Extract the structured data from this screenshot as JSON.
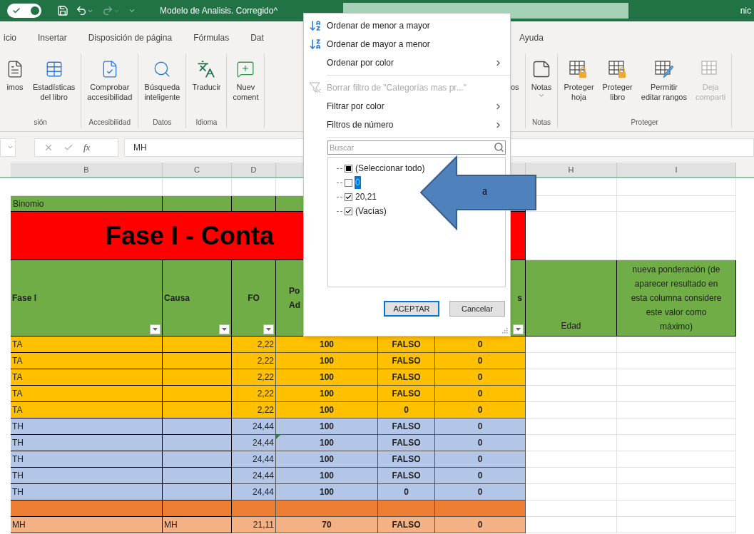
{
  "title_bar": {
    "autosave": {
      "on": true
    },
    "title": "Modelo de Analisis. Corregido^",
    "user": "nic"
  },
  "tabs": {
    "left": [
      {
        "label": "icio"
      },
      {
        "label": "Insertar"
      },
      {
        "label": "Disposición de página"
      },
      {
        "label": "Fórmulas"
      },
      {
        "label": "Dat"
      }
    ],
    "right": [
      {
        "label": "Ayuda"
      }
    ]
  },
  "ribbon": {
    "left_groups": [
      {
        "label": "sión",
        "buttons": [
          {
            "lines": [
              "imos"
            ]
          },
          {
            "lines": [
              "Estadísticas",
              "del libro"
            ]
          }
        ]
      },
      {
        "label": "Accesibilidad",
        "buttons": [
          {
            "lines": [
              "Comprobar",
              "accesibilidad"
            ]
          }
        ]
      },
      {
        "label": "Datos",
        "buttons": [
          {
            "lines": [
              "Búsqueda",
              "inteligente"
            ]
          }
        ]
      },
      {
        "label": "Idioma",
        "buttons": [
          {
            "lines": [
              "Traducir"
            ]
          }
        ]
      },
      {
        "buttons": [
          {
            "lines": [
              "Nuev",
              "coment"
            ]
          }
        ]
      }
    ],
    "right_groups": [
      {
        "buttons": [
          {
            "lines": [
              "os"
            ]
          }
        ]
      },
      {
        "label": "Notas",
        "buttons": [
          {
            "lines": [
              "Notas"
            ],
            "dropdown": true
          }
        ]
      },
      {
        "label": "Proteger",
        "buttons": [
          {
            "lines": [
              "Proteger",
              "hoja"
            ],
            "disabled": false
          },
          {
            "lines": [
              "Proteger",
              "libro"
            ],
            "disabled": false
          },
          {
            "lines": [
              "Permitir",
              "editar rangos"
            ],
            "disabled": false
          },
          {
            "lines": [
              "Deja",
              "comparti"
            ],
            "disabled": true
          }
        ]
      }
    ]
  },
  "formula_bar": {
    "function_label": "fx",
    "value": "MH"
  },
  "sheet": {
    "column_headers": [
      "B",
      "C",
      "D",
      "H",
      "I"
    ],
    "label_row": "Binomio",
    "title": "Fase I - Conta",
    "header": [
      {
        "lines": [
          "Fase I"
        ],
        "filter": true
      },
      {
        "lines": [
          "Causa"
        ],
        "filter": true
      },
      {
        "lines": [
          "FO"
        ],
        "filter": true
      },
      {
        "lines": [
          "Po",
          "Ad"
        ],
        "filter": false
      },
      {
        "lines": [
          "s"
        ],
        "filter": true
      },
      {
        "lines": [
          "Edad"
        ],
        "filter": false
      },
      {
        "lines": [
          "nueva ponderación (de",
          "aparecer resultado en",
          "esta columna considere",
          "este valor como",
          "máximo)"
        ],
        "filter": false
      }
    ],
    "rows": [
      {
        "color": "#ffc000",
        "marker": false,
        "fase_i": "TA",
        "fo": "2,22",
        "column_e": "100",
        "column_f": "FALSO",
        "column_g": "0"
      },
      {
        "color": "#ffc000",
        "marker": false,
        "fase_i": "TA",
        "fo": "2,22",
        "column_e": "100",
        "column_f": "FALSO",
        "column_g": "0"
      },
      {
        "color": "#ffc000",
        "marker": false,
        "fase_i": "TA",
        "fo": "2,22",
        "column_e": "100",
        "column_f": "FALSO",
        "column_g": "0"
      },
      {
        "color": "#ffc000",
        "marker": false,
        "fase_i": "TA",
        "fo": "2,22",
        "column_e": "100",
        "column_f": "FALSO",
        "column_g": "0"
      },
      {
        "color": "#ffc000",
        "marker": false,
        "fase_i": "TA",
        "fo": "2,22",
        "column_e": "100",
        "column_f": "0",
        "column_g": "0"
      },
      {
        "color": "#b4c6e7",
        "marker": false,
        "fase_i": "TH",
        "fo": "24,44",
        "column_e": "100",
        "column_f": "FALSO",
        "column_g": "0"
      },
      {
        "color": "#b4c6e7",
        "marker": true,
        "fase_i": "TH",
        "fo": "24,44",
        "column_e": "100",
        "column_f": "FALSO",
        "column_g": "0"
      },
      {
        "color": "#b4c6e7",
        "marker": false,
        "fase_i": "TH",
        "fo": "24,44",
        "column_e": "100",
        "column_f": "FALSO",
        "column_g": "0"
      },
      {
        "color": "#b4c6e7",
        "marker": false,
        "fase_i": "TH",
        "fo": "24,44",
        "column_e": "100",
        "column_f": "FALSO",
        "column_g": "0"
      },
      {
        "color": "#b4c6e7",
        "marker": false,
        "fase_i": "TH",
        "fo": "24,44",
        "column_e": "100",
        "column_f": "0",
        "column_g": "0"
      },
      {
        "color": "#ed7d31",
        "marker": false
      },
      {
        "color": "#f4b183",
        "marker": false,
        "fase_i": "MH",
        "causa": "MH",
        "fo": "21,11",
        "column_e": "70",
        "column_f": "FALSO",
        "column_g": "0"
      }
    ]
  },
  "filter_menu": {
    "items": [
      {
        "kind": "sort_asc",
        "label": "Ordenar de menor a mayor",
        "disabled": false
      },
      {
        "kind": "sort_desc",
        "label": "Ordenar de mayor a menor",
        "disabled": false
      },
      {
        "kind": "submenu",
        "label": "Ordenar por color",
        "disabled": false
      },
      {
        "kind": "separator"
      },
      {
        "kind": "clear",
        "label": "Borrar filtro de \"Categorías mas pr...\"",
        "disabled": true
      },
      {
        "kind": "submenu",
        "label": "Filtrar por color",
        "disabled": false
      },
      {
        "kind": "submenu",
        "label": "Filtros de número",
        "disabled": false
      },
      {
        "kind": "separator"
      }
    ],
    "search": {
      "placeholder": "Buscar"
    },
    "values": [
      {
        "kind": "select_all",
        "label": "(Seleccionar todo)",
        "partial": true,
        "selected": false
      },
      {
        "kind": "value",
        "label": "0",
        "checked": false,
        "selected": true
      },
      {
        "kind": "value",
        "label": "20,21",
        "checked": true,
        "selected": false
      },
      {
        "kind": "value",
        "label": "(Vacías)",
        "checked": true,
        "selected": false
      }
    ],
    "buttons": [
      {
        "label": "ACEPTAR",
        "default": true
      },
      {
        "label": "Cancelar",
        "default": false
      }
    ]
  },
  "annotation": {
    "label": "a"
  }
}
